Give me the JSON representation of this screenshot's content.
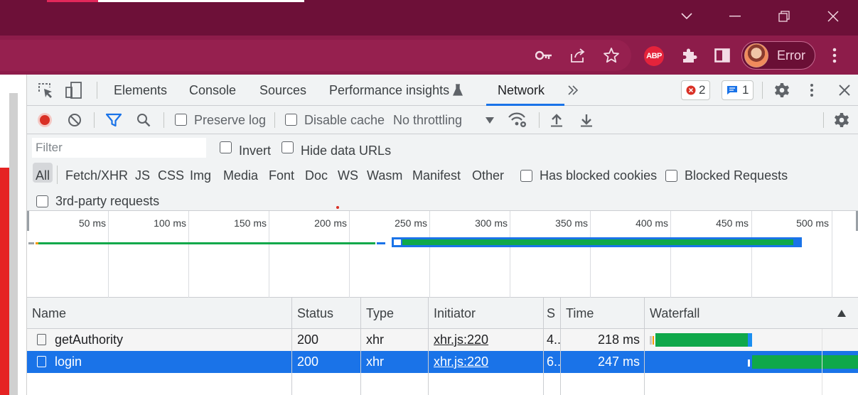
{
  "browser": {
    "profile_label": "Error",
    "abp_label": "ABP"
  },
  "devtools": {
    "tabs": [
      "Elements",
      "Console",
      "Sources",
      "Performance insights",
      "Network"
    ],
    "active_tab": "Network",
    "error_count": "2",
    "message_count": "1"
  },
  "network_toolbar": {
    "preserve_log": "Preserve log",
    "disable_cache": "Disable cache",
    "throttling": "No throttling"
  },
  "filter": {
    "placeholder": "Filter",
    "invert": "Invert",
    "hide_data_urls": "Hide data URLs",
    "types": [
      "All",
      "Fetch/XHR",
      "JS",
      "CSS",
      "Img",
      "Media",
      "Font",
      "Doc",
      "WS",
      "Wasm",
      "Manifest",
      "Other"
    ],
    "has_blocked_cookies": "Has blocked cookies",
    "blocked_requests": "Blocked Requests",
    "third_party": "3rd-party requests"
  },
  "overview": {
    "ticks": [
      "50 ms",
      "100 ms",
      "150 ms",
      "200 ms",
      "250 ms",
      "300 ms",
      "350 ms",
      "400 ms",
      "450 ms",
      "500 ms"
    ]
  },
  "table": {
    "columns": [
      "Name",
      "Status",
      "Type",
      "Initiator",
      "S",
      "Time",
      "Waterfall"
    ],
    "rows": [
      {
        "name": "getAuthority",
        "status": "200",
        "type": "xhr",
        "initiator": "xhr.js:220",
        "size": "4..",
        "time": "218 ms"
      },
      {
        "name": "login",
        "status": "200",
        "type": "xhr",
        "initiator": "xhr.js:220",
        "size": "6..",
        "time": "247 ms"
      }
    ]
  },
  "colors": {
    "titlebar": "#6d1038",
    "toolbar": "#8d1c4a",
    "accent": "#1a73e8",
    "waterfall_green": "#0fa84a"
  }
}
